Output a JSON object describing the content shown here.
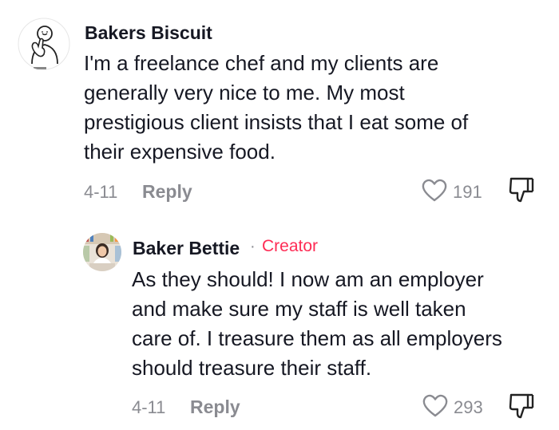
{
  "comments": [
    {
      "username": "Bakers Biscuit",
      "text": "I'm a freelance chef and my clients are\ngenerally very nice to me. My most\nprestigious client insists that I eat some of\ntheir expensive food.",
      "date": "4-11",
      "reply_label": "Reply",
      "likes": "191",
      "avatar_icon": "sign-language-avatar"
    },
    {
      "username": "Baker Bettie",
      "separator": "·",
      "badge": "Creator",
      "text": "As they should! I now am an employer\nand make sure my staff is well taken\ncare of. I treasure them as all employers\nshould treasure their staff.",
      "date": "4-11",
      "reply_label": "Reply",
      "likes": "293",
      "avatar_icon": "profile-photo-avatar"
    }
  ],
  "icons": {
    "like": "heart-icon",
    "dislike": "thumbs-down-icon"
  },
  "colors": {
    "text": "#161823",
    "muted": "#8a8b91",
    "creator": "#fe2c55"
  }
}
